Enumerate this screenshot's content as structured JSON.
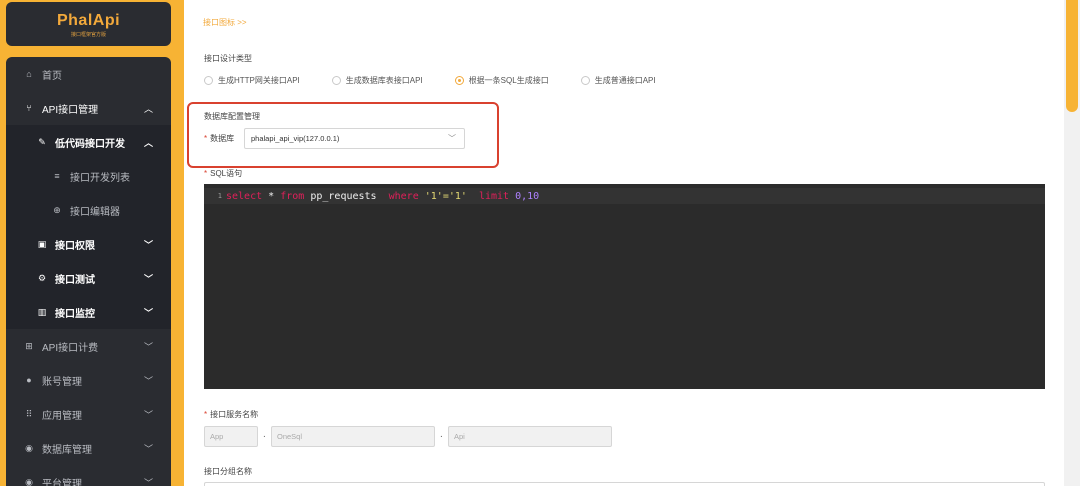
{
  "logo": {
    "title": "PhalApi",
    "subtitle": "接口框架官方版"
  },
  "sidebar": {
    "items": [
      {
        "label": "首页",
        "icon": "home-icon"
      },
      {
        "label": "API接口管理",
        "icon": "api-icon",
        "expanded": true
      },
      {
        "label": "低代码接口开发",
        "icon": "wrench-icon",
        "expanded": true
      },
      {
        "label": "接口开发列表",
        "icon": "list-icon"
      },
      {
        "label": "接口编辑器",
        "icon": "plus-circle-icon"
      },
      {
        "label": "接口权限",
        "icon": "lock-icon"
      },
      {
        "label": "接口测试",
        "icon": "test-icon"
      },
      {
        "label": "接口监控",
        "icon": "bar-chart-icon"
      },
      {
        "label": "API接口计费",
        "icon": "cart-icon"
      },
      {
        "label": "账号管理",
        "icon": "user-icon"
      },
      {
        "label": "应用管理",
        "icon": "grid-icon"
      },
      {
        "label": "数据库管理",
        "icon": "database-icon"
      },
      {
        "label": "平台管理",
        "icon": "settings-icon"
      }
    ]
  },
  "main": {
    "breadcrumb": "接口图标 >>",
    "design_type_label": "接口设计类型",
    "design_types": [
      {
        "label": "生成HTTP网关接口API",
        "checked": false
      },
      {
        "label": "生成数据库表接口API",
        "checked": false
      },
      {
        "label": "根据一条SQL生成接口",
        "checked": true
      },
      {
        "label": "生成普通接口API",
        "checked": false
      }
    ],
    "db_section_title": "数据库配置管理",
    "db_label": "数据库",
    "db_value": "phalapi_api_vip(127.0.0.1)",
    "sql_label": "SQL语句",
    "sql_line_no": "1",
    "sql_tokens": {
      "select": "select",
      "star": "*",
      "from": "from",
      "table": "pp_requests",
      "where": "where",
      "cond": "'1'='1'",
      "limit": "limit",
      "range": "0,10"
    },
    "service_label": "接口服务名称",
    "service_inputs": {
      "app": "App",
      "name": "OneSql",
      "api": "Api"
    },
    "service_sep": ".",
    "group_label": "接口分组名称",
    "required_mark": "*"
  },
  "colors": {
    "accent": "#f7b334",
    "sidebar_bg": "#2a2c31",
    "highlight": "#d9412f",
    "editor_bg": "#2b2b2b"
  }
}
